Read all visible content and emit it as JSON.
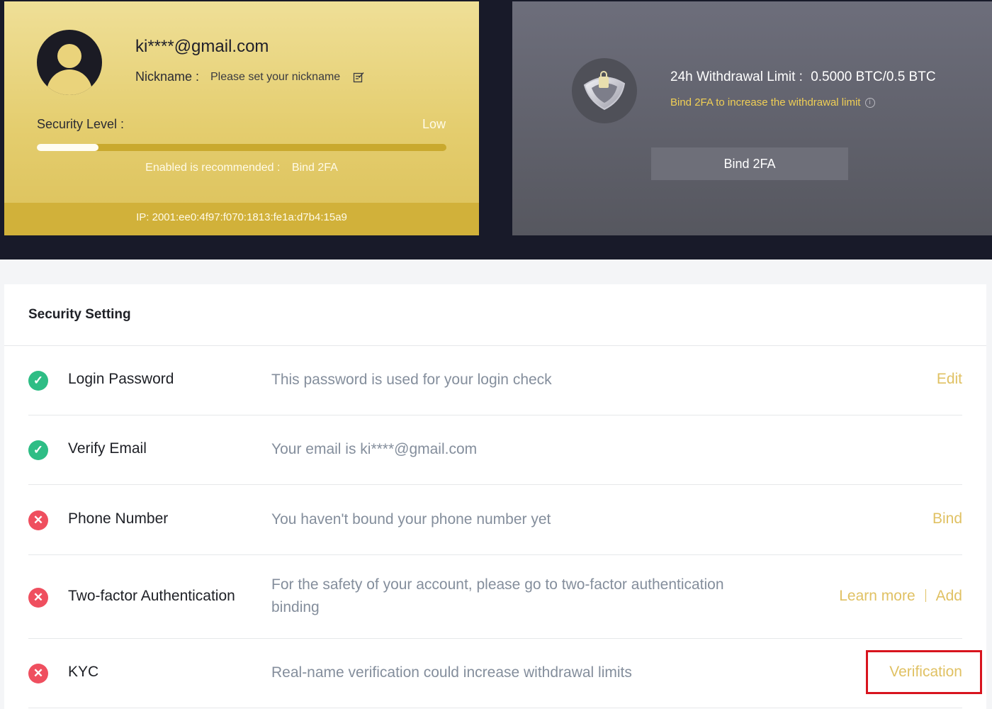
{
  "profile": {
    "email": "ki****@gmail.com",
    "nickname_label": "Nickname :",
    "nickname_value": "Please set your nickname",
    "security_label": "Security Level :",
    "security_value": "Low",
    "security_progress_percent": 15,
    "recommend_label": "Enabled is recommended :",
    "recommend_action": "Bind 2FA",
    "ip": "IP: 2001:ee0:4f97:f070:1813:fe1a:d7b4:15a9"
  },
  "withdrawal": {
    "limit_label": "24h Withdrawal Limit :",
    "limit_value": "0.5000 BTC/0.5 BTC",
    "hint": "Bind 2FA to increase the withdrawal limit",
    "bind_button": "Bind 2FA"
  },
  "security_setting": {
    "title": "Security Setting",
    "rows": [
      {
        "name": "Login Password",
        "status": "enabled",
        "desc": "This password is used for your login check",
        "action": "Edit"
      },
      {
        "name": "Verify Email",
        "status": "enabled",
        "desc": "Your email is ki****@gmail.com",
        "action": ""
      },
      {
        "name": "Phone Number",
        "status": "disabled",
        "desc": "You haven't bound your phone number yet",
        "action": "Bind"
      },
      {
        "name": "Two-factor Authentication",
        "status": "disabled",
        "desc": "For the safety of your account, please go to two-factor authentication binding",
        "action_1": "Learn more",
        "action_2": "Add"
      },
      {
        "name": "KYC",
        "status": "disabled",
        "desc": "Real-name verification could increase withdrawal limits",
        "action": "Verification"
      }
    ]
  },
  "colors": {
    "gold_accent": "#e0c163",
    "ok": "#2ebd85",
    "error": "#ef4f5f",
    "highlight_box": "#d8141e"
  },
  "icons": {
    "ok": "check-circle-icon",
    "error": "close-circle-icon",
    "edit": "edit-icon",
    "info": "info-icon",
    "shield": "shield-icon",
    "avatar": "user-avatar-icon"
  }
}
